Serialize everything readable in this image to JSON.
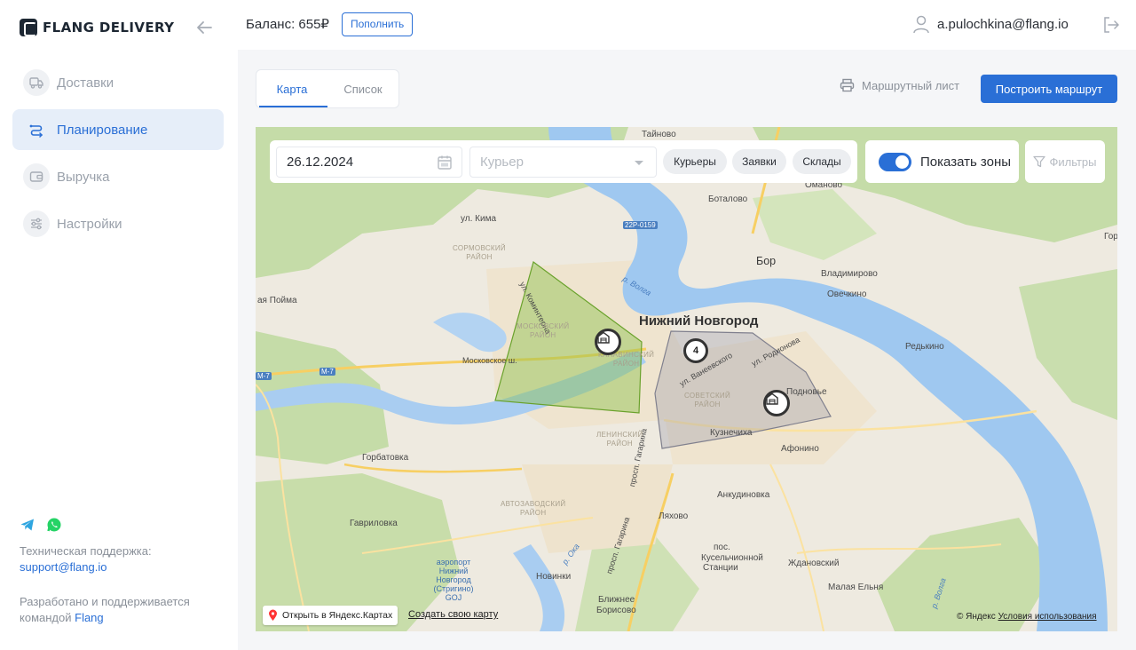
{
  "app": {
    "brand": "FLANG DELIVERY",
    "accent_color": "#2a6fd6"
  },
  "sidebar": {
    "items": [
      {
        "label": "Доставки",
        "icon": "box-truck-icon",
        "active": false
      },
      {
        "label": "Планирование",
        "icon": "route-icon",
        "active": true
      },
      {
        "label": "Выручка",
        "icon": "wallet-icon",
        "active": false
      },
      {
        "label": "Настройки",
        "icon": "sliders-icon",
        "active": false
      }
    ],
    "support_label": "Техническая поддержка:",
    "support_email": "support@flang.io",
    "credits_line1": "Разработано и поддерживается",
    "credits_line2": "командой",
    "credits_link": "Flang"
  },
  "header": {
    "balance": "Баланс: 655₽",
    "topup_label": "Пополнить",
    "user_email": "a.pulochkina@flang.io"
  },
  "view_tabs": [
    {
      "label": "Карта",
      "active": true
    },
    {
      "label": "Список",
      "active": false
    }
  ],
  "toolbar": {
    "route_sheet_label": "Маршрутный лист",
    "build_route_label": "Построить маршрут"
  },
  "map_controls": {
    "date_value": "26.12.2024",
    "courier_placeholder": "Курьер",
    "chips": [
      "Курьеры",
      "Заявки",
      "Склады"
    ],
    "show_zones_label": "Показать зоны",
    "show_zones_enabled": true,
    "filters_label": "Фильтры"
  },
  "map": {
    "city": "Нижний Новгород",
    "cluster_count": "4",
    "places": {
      "taynovo": "Тайново",
      "omanovo": "Оманово",
      "botalovo": "Боталово",
      "kima": "ул. Кима",
      "road_22p": "22Р-0159",
      "bor": "Бор",
      "vladimirovo": "Владимирово",
      "ovechkino": "Овечкино",
      "gor": "Гор",
      "redkino": "Редькино",
      "podnovye": "Подновье",
      "afonino": "Афонино",
      "kuznechikha": "Кузнечиха",
      "ankudinovka": "Анкудиновка",
      "lyakhovo": "Ляхово",
      "kurchatovo": "пос.",
      "kurchatovo2": "Кусельчионной",
      "kurchatovo3": "Станции",
      "zhdanovsky": "Ждановский",
      "malaya_elnya": "Малая Ельня",
      "novinki": "Новинки",
      "blizhnee": "Ближнее",
      "borisovo": "Борисово",
      "gavrilovka": "Гавриловка",
      "gorbatovka": "Горбатовка",
      "novaya_poyma": "ая Пойма",
      "moskovskoe_sh": "Московское ш.",
      "m7": "М-7",
      "m7b": "М-7",
      "kominterna": "ул. Коминтерна",
      "rodionova": "ул. Родионова",
      "vaneeva": "ул. Ванеевского",
      "prosp_gagarina": "просп. Гагарина",
      "prosp_gagarina2": "просп. Гагарина",
      "airport1": "аэропорт",
      "airport2": "Нижний",
      "airport3": "Новгород",
      "airport4": "(Стригино)",
      "airport5": "GOJ",
      "volga1": "р. Волга",
      "oka": "р. Ока",
      "volga2": "р. Волга"
    },
    "districts": {
      "sormovsky": [
        "СОРМОВСКИЙ",
        "РАЙОН"
      ],
      "moskovsky": [
        "МОСКОВСКИЙ",
        "РАЙОН"
      ],
      "kanavinsky": [
        "КАНАВИНСКИЙ",
        "РАЙОН"
      ],
      "sovetsky": [
        "СОВЕТСКИЙ",
        "РАЙОН"
      ],
      "leninsky": [
        "ЛЕНИНСКИЙ",
        "РАЙОН"
      ],
      "avtozavodsky": [
        "АВТОЗАВОДСКИЙ",
        "РАЙОН"
      ]
    },
    "open_in_yandex": "Открыть в Яндекс.Картах",
    "create_map": "Создать свою карту",
    "copyright": "© Яндекс",
    "terms": "Условия использования",
    "zone_colors": {
      "zone1": "#8cc04a",
      "zone2": "#9a9aa8"
    }
  }
}
